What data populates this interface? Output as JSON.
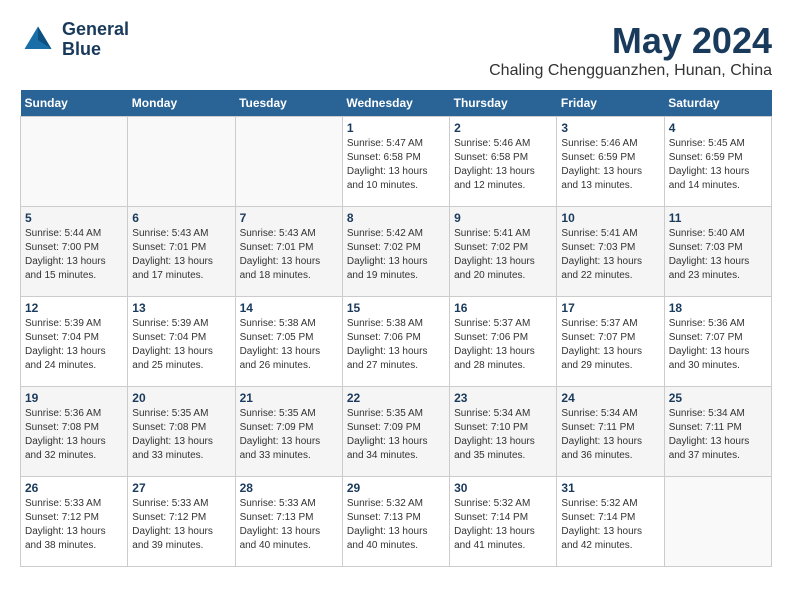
{
  "header": {
    "logo_line1": "General",
    "logo_line2": "Blue",
    "month_year": "May 2024",
    "location": "Chaling Chengguanzhen, Hunan, China"
  },
  "weekdays": [
    "Sunday",
    "Monday",
    "Tuesday",
    "Wednesday",
    "Thursday",
    "Friday",
    "Saturday"
  ],
  "weeks": [
    [
      {
        "day": "",
        "info": ""
      },
      {
        "day": "",
        "info": ""
      },
      {
        "day": "",
        "info": ""
      },
      {
        "day": "1",
        "info": "Sunrise: 5:47 AM\nSunset: 6:58 PM\nDaylight: 13 hours\nand 10 minutes."
      },
      {
        "day": "2",
        "info": "Sunrise: 5:46 AM\nSunset: 6:58 PM\nDaylight: 13 hours\nand 12 minutes."
      },
      {
        "day": "3",
        "info": "Sunrise: 5:46 AM\nSunset: 6:59 PM\nDaylight: 13 hours\nand 13 minutes."
      },
      {
        "day": "4",
        "info": "Sunrise: 5:45 AM\nSunset: 6:59 PM\nDaylight: 13 hours\nand 14 minutes."
      }
    ],
    [
      {
        "day": "5",
        "info": "Sunrise: 5:44 AM\nSunset: 7:00 PM\nDaylight: 13 hours\nand 15 minutes."
      },
      {
        "day": "6",
        "info": "Sunrise: 5:43 AM\nSunset: 7:01 PM\nDaylight: 13 hours\nand 17 minutes."
      },
      {
        "day": "7",
        "info": "Sunrise: 5:43 AM\nSunset: 7:01 PM\nDaylight: 13 hours\nand 18 minutes."
      },
      {
        "day": "8",
        "info": "Sunrise: 5:42 AM\nSunset: 7:02 PM\nDaylight: 13 hours\nand 19 minutes."
      },
      {
        "day": "9",
        "info": "Sunrise: 5:41 AM\nSunset: 7:02 PM\nDaylight: 13 hours\nand 20 minutes."
      },
      {
        "day": "10",
        "info": "Sunrise: 5:41 AM\nSunset: 7:03 PM\nDaylight: 13 hours\nand 22 minutes."
      },
      {
        "day": "11",
        "info": "Sunrise: 5:40 AM\nSunset: 7:03 PM\nDaylight: 13 hours\nand 23 minutes."
      }
    ],
    [
      {
        "day": "12",
        "info": "Sunrise: 5:39 AM\nSunset: 7:04 PM\nDaylight: 13 hours\nand 24 minutes."
      },
      {
        "day": "13",
        "info": "Sunrise: 5:39 AM\nSunset: 7:04 PM\nDaylight: 13 hours\nand 25 minutes."
      },
      {
        "day": "14",
        "info": "Sunrise: 5:38 AM\nSunset: 7:05 PM\nDaylight: 13 hours\nand 26 minutes."
      },
      {
        "day": "15",
        "info": "Sunrise: 5:38 AM\nSunset: 7:06 PM\nDaylight: 13 hours\nand 27 minutes."
      },
      {
        "day": "16",
        "info": "Sunrise: 5:37 AM\nSunset: 7:06 PM\nDaylight: 13 hours\nand 28 minutes."
      },
      {
        "day": "17",
        "info": "Sunrise: 5:37 AM\nSunset: 7:07 PM\nDaylight: 13 hours\nand 29 minutes."
      },
      {
        "day": "18",
        "info": "Sunrise: 5:36 AM\nSunset: 7:07 PM\nDaylight: 13 hours\nand 30 minutes."
      }
    ],
    [
      {
        "day": "19",
        "info": "Sunrise: 5:36 AM\nSunset: 7:08 PM\nDaylight: 13 hours\nand 32 minutes."
      },
      {
        "day": "20",
        "info": "Sunrise: 5:35 AM\nSunset: 7:08 PM\nDaylight: 13 hours\nand 33 minutes."
      },
      {
        "day": "21",
        "info": "Sunrise: 5:35 AM\nSunset: 7:09 PM\nDaylight: 13 hours\nand 33 minutes."
      },
      {
        "day": "22",
        "info": "Sunrise: 5:35 AM\nSunset: 7:09 PM\nDaylight: 13 hours\nand 34 minutes."
      },
      {
        "day": "23",
        "info": "Sunrise: 5:34 AM\nSunset: 7:10 PM\nDaylight: 13 hours\nand 35 minutes."
      },
      {
        "day": "24",
        "info": "Sunrise: 5:34 AM\nSunset: 7:11 PM\nDaylight: 13 hours\nand 36 minutes."
      },
      {
        "day": "25",
        "info": "Sunrise: 5:34 AM\nSunset: 7:11 PM\nDaylight: 13 hours\nand 37 minutes."
      }
    ],
    [
      {
        "day": "26",
        "info": "Sunrise: 5:33 AM\nSunset: 7:12 PM\nDaylight: 13 hours\nand 38 minutes."
      },
      {
        "day": "27",
        "info": "Sunrise: 5:33 AM\nSunset: 7:12 PM\nDaylight: 13 hours\nand 39 minutes."
      },
      {
        "day": "28",
        "info": "Sunrise: 5:33 AM\nSunset: 7:13 PM\nDaylight: 13 hours\nand 40 minutes."
      },
      {
        "day": "29",
        "info": "Sunrise: 5:32 AM\nSunset: 7:13 PM\nDaylight: 13 hours\nand 40 minutes."
      },
      {
        "day": "30",
        "info": "Sunrise: 5:32 AM\nSunset: 7:14 PM\nDaylight: 13 hours\nand 41 minutes."
      },
      {
        "day": "31",
        "info": "Sunrise: 5:32 AM\nSunset: 7:14 PM\nDaylight: 13 hours\nand 42 minutes."
      },
      {
        "day": "",
        "info": ""
      }
    ]
  ]
}
